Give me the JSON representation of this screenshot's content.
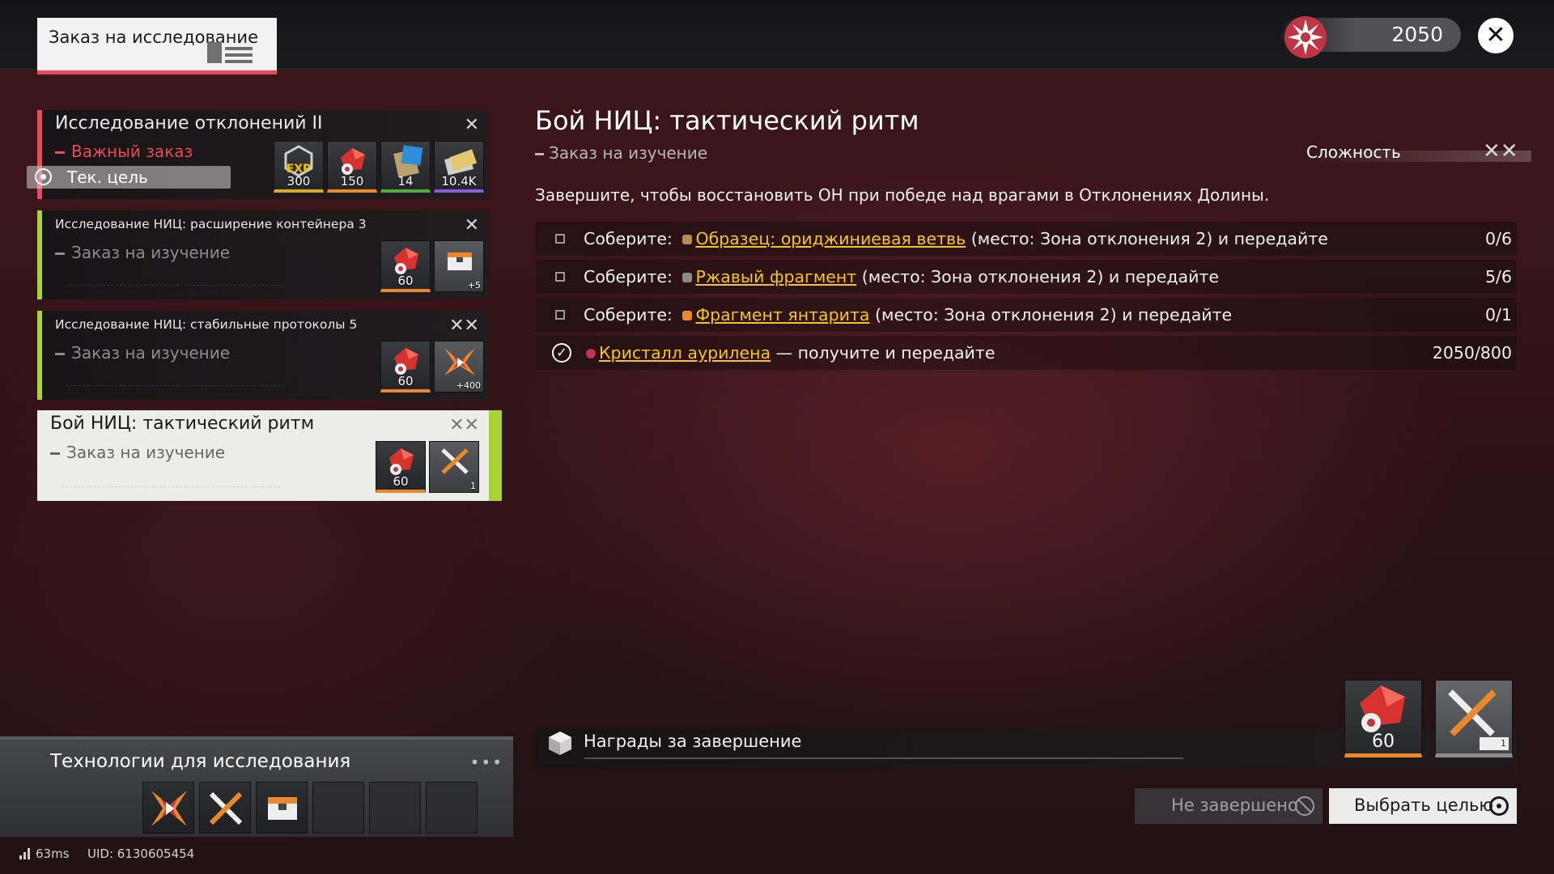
{
  "header": {
    "title": "Заказ на исследование",
    "currency_amount": "2050"
  },
  "quests": [
    {
      "name": "Исследование отклонений II",
      "subtitle": "Важный заказ",
      "current_goal": "Тек. цель",
      "rewards": [
        "300",
        "150",
        "14",
        "10.4K"
      ]
    },
    {
      "name": "Исследование НИЦ: расширение контейнера 3",
      "subtitle": "Заказ на изучение",
      "rewards": [
        "60",
        "+5"
      ]
    },
    {
      "name": "Исследование НИЦ: стабильные протоколы 5",
      "subtitle": "Заказ на изучение",
      "rewards": [
        "60",
        "+400"
      ]
    },
    {
      "name": "Бой НИЦ: тактический ритм",
      "subtitle": "Заказ на изучение",
      "rewards": [
        "60",
        "1"
      ]
    }
  ],
  "detail": {
    "title": "Бой НИЦ: тактический ритм",
    "subtitle": "Заказ на изучение",
    "difficulty_label": "Сложность",
    "description": "Завершите, чтобы восстановить ОН при победе над врагами в Отклонениях Долины.",
    "objectives": [
      {
        "prefix": "Соберите:",
        "item": "Образец: ориджиниевая ветвь",
        "suffix": "(место: Зона отклонения 2) и передайте",
        "progress": "0/6",
        "done": false
      },
      {
        "prefix": "Соберите:",
        "item": "Ржавый фрагмент",
        "suffix": "(место: Зона отклонения 2) и передайте",
        "progress": "5/6",
        "done": false
      },
      {
        "prefix": "Соберите:",
        "item": "Фрагмент янтарита",
        "suffix": "(место: Зона отклонения 2) и передайте",
        "progress": "0/1",
        "done": false
      },
      {
        "prefix": "",
        "item": "Кристалл аурилена",
        "suffix": "— получите и передайте",
        "progress": "2050/800",
        "done": true
      }
    ],
    "rewards_label": "Награды за завершение",
    "rewards": [
      "60",
      "1"
    ],
    "button_incomplete": "Не завершено",
    "button_target": "Выбрать целью"
  },
  "tech": {
    "title": "Технологии для исследования",
    "more": "•••"
  },
  "status": {
    "ping": "63ms",
    "uid": "UID: 6130605454"
  },
  "colors": {
    "accent_green": "#a8d433",
    "accent_red": "#e84b5c",
    "link_yellow": "#f5c518"
  }
}
